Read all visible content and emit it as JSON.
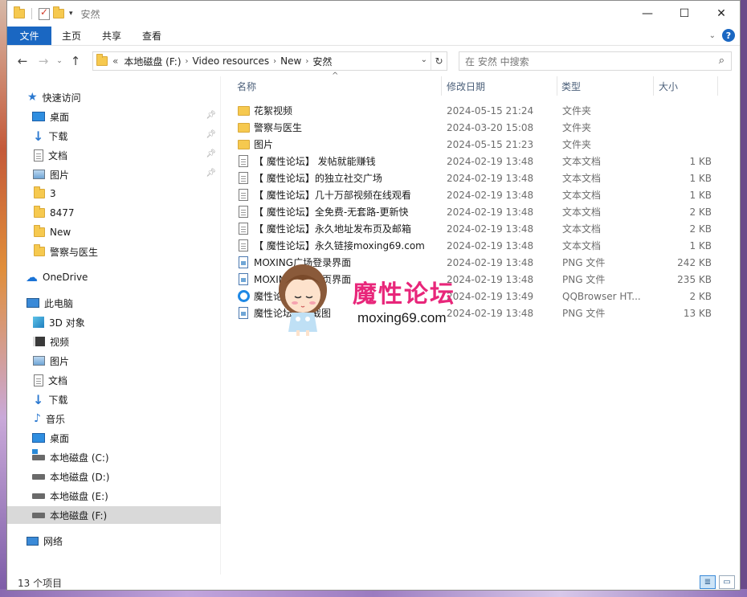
{
  "window": {
    "title": "安然",
    "controls": {
      "minimize": "—",
      "maximize": "☐",
      "close": "✕"
    }
  },
  "ribbon": {
    "tabs": [
      "文件",
      "主页",
      "共享",
      "查看"
    ],
    "help": "?"
  },
  "nav": {
    "breadcrumb_lead": "«",
    "breadcrumb": [
      "本地磁盘 (F:)",
      "Video resources",
      "New",
      "安然"
    ],
    "search_placeholder": "在 安然 中搜索"
  },
  "sidebar": {
    "quick_access": "快速访问",
    "pinned": [
      "桌面",
      "下载",
      "文档",
      "图片"
    ],
    "recent": [
      "3",
      "8477",
      "New",
      "警察与医生"
    ],
    "onedrive": "OneDrive",
    "this_pc": "此电脑",
    "pc_items": [
      "3D 对象",
      "视频",
      "图片",
      "文档",
      "下载",
      "音乐",
      "桌面"
    ],
    "drives": [
      "本地磁盘 (C:)",
      "本地磁盘 (D:)",
      "本地磁盘 (E:)",
      "本地磁盘 (F:)"
    ],
    "network": "网络"
  },
  "columns": {
    "name": "名称",
    "date": "修改日期",
    "type": "类型",
    "size": "大小"
  },
  "files": [
    {
      "name": "花絮视频",
      "date": "2024-05-15 21:24",
      "type": "文件夹",
      "size": "",
      "icon": "folder-icon"
    },
    {
      "name": "警察与医生",
      "date": "2024-03-20 15:08",
      "type": "文件夹",
      "size": "",
      "icon": "folder-icon"
    },
    {
      "name": "图片",
      "date": "2024-05-15 21:23",
      "type": "文件夹",
      "size": "",
      "icon": "folder-icon"
    },
    {
      "name": "【 魔性论坛】 发帖就能赚钱",
      "date": "2024-02-19 13:48",
      "type": "文本文档",
      "size": "1 KB",
      "icon": "text-file-icon"
    },
    {
      "name": "【 魔性论坛】的独立社交广场",
      "date": "2024-02-19 13:48",
      "type": "文本文档",
      "size": "1 KB",
      "icon": "text-file-icon"
    },
    {
      "name": "【 魔性论坛】几十万部视频在线观看",
      "date": "2024-02-19 13:48",
      "type": "文本文档",
      "size": "1 KB",
      "icon": "text-file-icon"
    },
    {
      "name": "【 魔性论坛】全免费-无套路-更新快",
      "date": "2024-02-19 13:48",
      "type": "文本文档",
      "size": "2 KB",
      "icon": "text-file-icon"
    },
    {
      "name": "【 魔性论坛】永久地址发布页及邮箱",
      "date": "2024-02-19 13:48",
      "type": "文本文档",
      "size": "2 KB",
      "icon": "text-file-icon"
    },
    {
      "name": "【 魔性论坛】永久链接moxing69.com",
      "date": "2024-02-19 13:48",
      "type": "文本文档",
      "size": "1 KB",
      "icon": "text-file-icon"
    },
    {
      "name": "MOXING广场登录界面",
      "date": "2024-02-19 13:48",
      "type": "PNG 文件",
      "size": "242 KB",
      "icon": "png-file-icon"
    },
    {
      "name": "MOXING论坛主页界面",
      "date": "2024-02-19 13:48",
      "type": "PNG 文件",
      "size": "235 KB",
      "icon": "png-file-icon"
    },
    {
      "name": "魔性论坛发布器",
      "date": "2024-02-19 13:49",
      "type": "QQBrowser HT...",
      "size": "2 KB",
      "icon": "qqbrowser-icon"
    },
    {
      "name": "魔性论坛首页截图",
      "date": "2024-02-19 13:48",
      "type": "PNG 文件",
      "size": "13 KB",
      "icon": "png-file-icon"
    }
  ],
  "watermark": {
    "brand": "魔性论坛",
    "url": "moxing69.com"
  },
  "status": {
    "item_count": "13 个项目"
  }
}
